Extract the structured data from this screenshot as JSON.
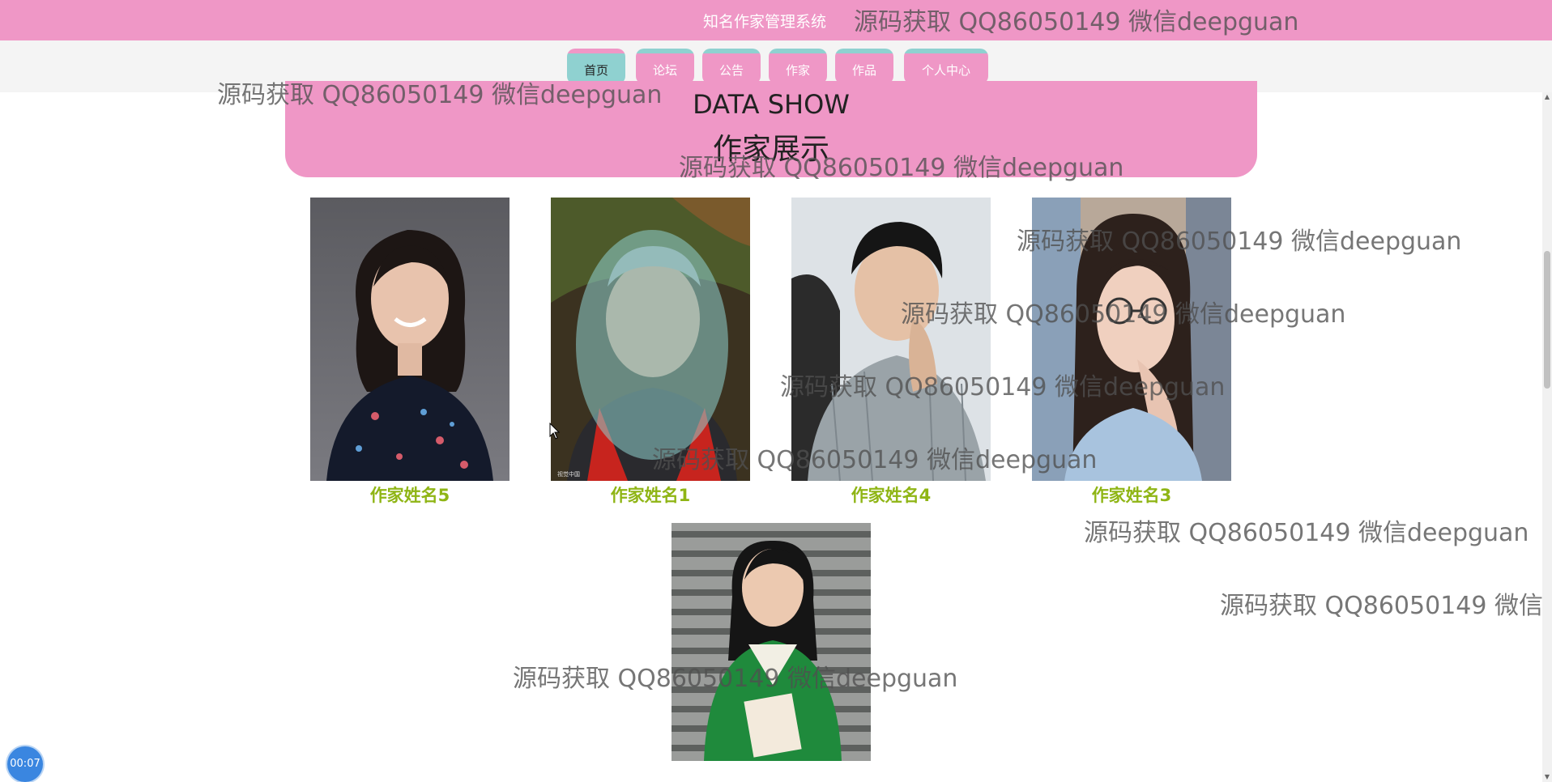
{
  "header": {
    "system_title": "知名作家管理系统"
  },
  "nav": {
    "items": [
      {
        "label": "首页",
        "active": true
      },
      {
        "label": "论坛",
        "active": false
      },
      {
        "label": "公告",
        "active": false
      },
      {
        "label": "作家",
        "active": false
      },
      {
        "label": "作品",
        "active": false
      },
      {
        "label": "个人中心",
        "active": false
      }
    ]
  },
  "section": {
    "title_en": "DATA SHOW",
    "title_cn": "作家展示"
  },
  "authors": [
    {
      "name": "作家姓名5"
    },
    {
      "name": "作家姓名1"
    },
    {
      "name": "作家姓名4"
    },
    {
      "name": "作家姓名3"
    },
    {
      "name": ""
    }
  ],
  "watermark": {
    "text": "源码获取 QQ86050149 微信deepguan",
    "truncated_text": "源码获取 QQ86050149 微信d"
  },
  "timer": {
    "label": "00:07"
  },
  "colors": {
    "header_pink": "#ef97c6",
    "nav_teal": "#8fd1d0",
    "author_name_green": "#8fb515",
    "nav_band_gray": "#f4f4f4",
    "timer_blue": "#3a86e0"
  },
  "icons": {
    "cursor": "mouse-pointer-icon",
    "scroll_up": "scroll-up-arrow-icon",
    "scroll_down": "scroll-down-arrow-icon"
  }
}
